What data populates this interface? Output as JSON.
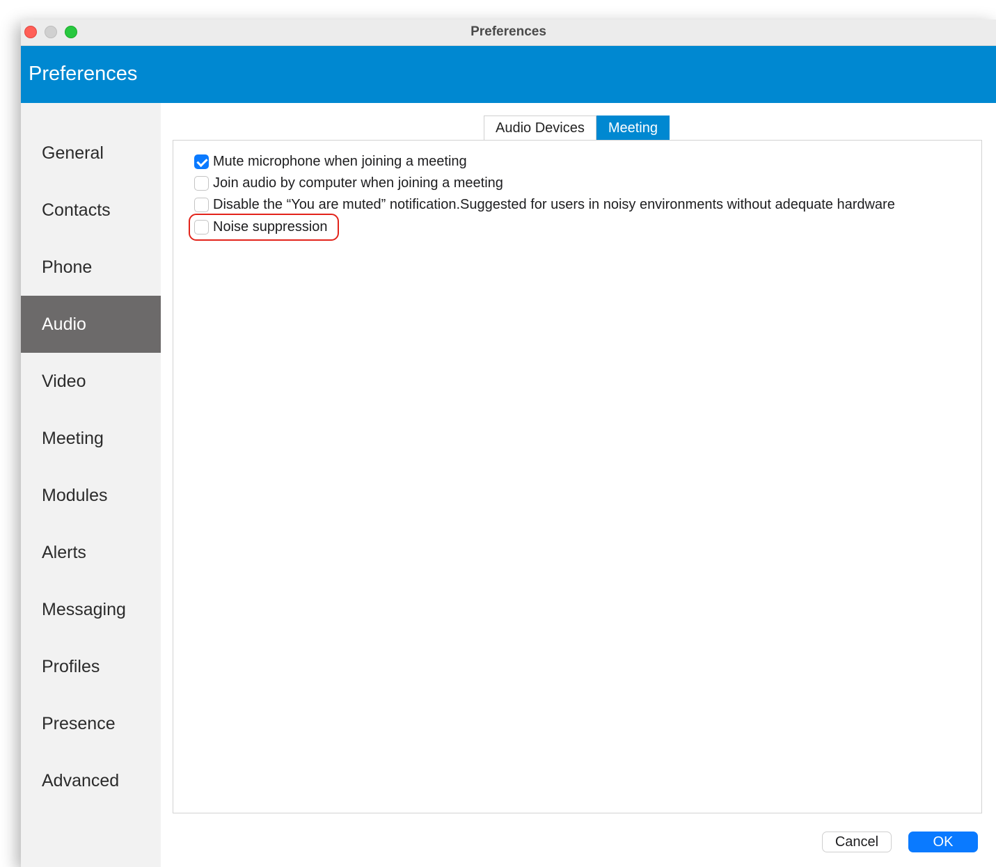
{
  "window": {
    "title": "Preferences"
  },
  "header": {
    "title": "Preferences",
    "color": "#0088d1"
  },
  "sidebar": {
    "items": [
      {
        "label": "General"
      },
      {
        "label": "Contacts"
      },
      {
        "label": "Phone"
      },
      {
        "label": "Audio",
        "active": true
      },
      {
        "label": "Video"
      },
      {
        "label": "Meeting"
      },
      {
        "label": "Modules"
      },
      {
        "label": "Alerts"
      },
      {
        "label": "Messaging"
      },
      {
        "label": "Profiles"
      },
      {
        "label": "Presence"
      },
      {
        "label": "Advanced"
      }
    ]
  },
  "tabs": [
    {
      "label": "Audio Devices",
      "active": false
    },
    {
      "label": "Meeting",
      "active": true
    }
  ],
  "options": [
    {
      "label": "Mute microphone when joining a meeting",
      "checked": true
    },
    {
      "label": "Join audio by computer when joining a meeting",
      "checked": false
    },
    {
      "label": "Disable the “You are muted” notification.Suggested for users in noisy environments without adequate hardware",
      "checked": false
    },
    {
      "label": "Noise suppression",
      "checked": false,
      "highlighted": true
    }
  ],
  "footer": {
    "cancel_label": "Cancel",
    "ok_label": "OK"
  },
  "colors": {
    "accent": "#0088d1",
    "checkbox_checked": "#0a7aff",
    "sidebar_active": "#6c6a6a",
    "highlight": "#e2231a"
  }
}
